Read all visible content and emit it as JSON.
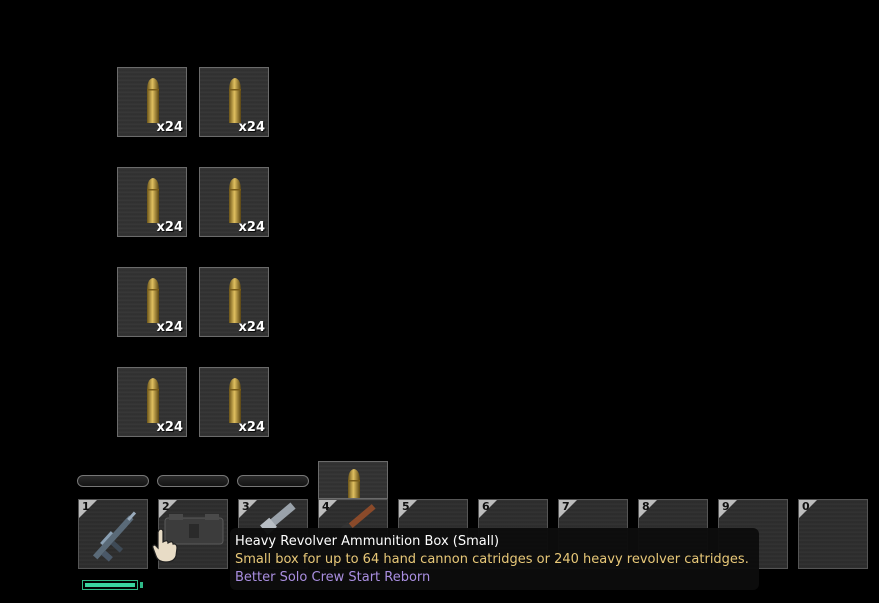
{
  "container": {
    "items": [
      {
        "name": "heavy-revolver-round",
        "quantity": "x24"
      },
      {
        "name": "heavy-revolver-round",
        "quantity": "x24"
      },
      {
        "name": "heavy-revolver-round",
        "quantity": "x24"
      },
      {
        "name": "heavy-revolver-round",
        "quantity": "x24"
      },
      {
        "name": "heavy-revolver-round",
        "quantity": "x24"
      },
      {
        "name": "heavy-revolver-round",
        "quantity": "x24"
      },
      {
        "name": "heavy-revolver-round",
        "quantity": "x24"
      },
      {
        "name": "heavy-revolver-round",
        "quantity": "x24"
      }
    ]
  },
  "hotbar": {
    "slots": [
      {
        "key": "1",
        "item": "rifle-icon"
      },
      {
        "key": "2",
        "item": "ammo-box-icon"
      },
      {
        "key": "3",
        "item": "revolver-icon"
      },
      {
        "key": "4",
        "item": "shotgun-icon"
      },
      {
        "key": "5",
        "item": ""
      },
      {
        "key": "6",
        "item": ""
      },
      {
        "key": "7",
        "item": ""
      },
      {
        "key": "8",
        "item": ""
      },
      {
        "key": "9",
        "item": ""
      },
      {
        "key": "0",
        "item": ""
      }
    ]
  },
  "tooltip": {
    "title": "Heavy Revolver Ammunition Box (Small)",
    "description": "Small box for up to 64 hand cannon catridges or 240 heavy revolver catridges.",
    "mod": "Better Solo Crew Start Reborn"
  },
  "condition": 1.0,
  "colors": {
    "description": "#e8c878",
    "mod": "#a98ee0",
    "condition": "#3ad4a0"
  }
}
